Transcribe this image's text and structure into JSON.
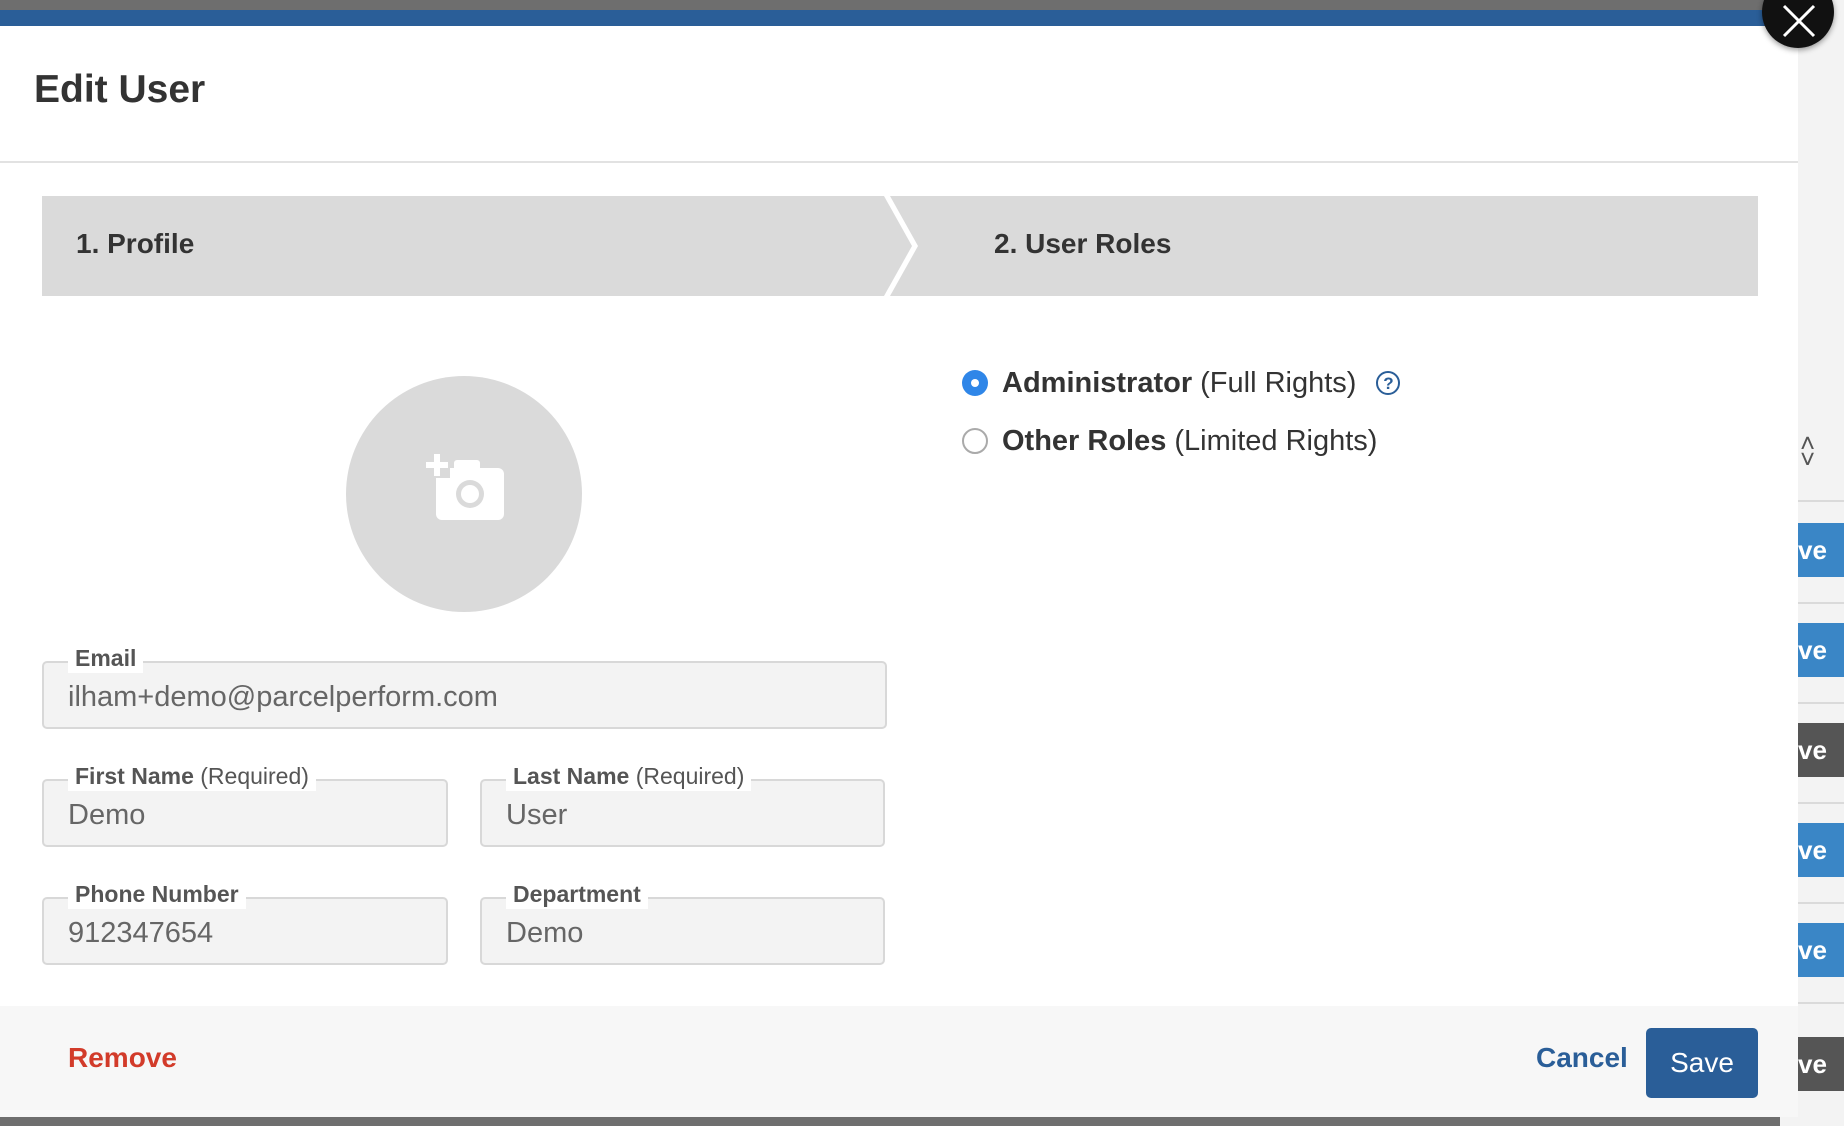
{
  "modal": {
    "title": "Edit User",
    "close_icon": "close-icon"
  },
  "steps": [
    {
      "label": "1. Profile"
    },
    {
      "label": "2. User Roles"
    }
  ],
  "profile": {
    "avatar_icon": "add-photo-icon",
    "email": {
      "label": "Email",
      "value": "ilham+demo@parcelperform.com"
    },
    "first_name": {
      "label": "First Name",
      "hint": "(Required)",
      "value": "Demo"
    },
    "last_name": {
      "label": "Last Name",
      "hint": "(Required)",
      "value": "User"
    },
    "phone": {
      "label": "Phone Number",
      "value": "912347654"
    },
    "department": {
      "label": "Department",
      "value": "Demo"
    }
  },
  "roles": [
    {
      "name": "Administrator",
      "detail": "(Full Rights)",
      "selected": true
    },
    {
      "name": "Other Roles",
      "detail": "(Limited Rights)",
      "selected": false
    }
  ],
  "help_icon": "help-icon",
  "footer": {
    "remove_label": "Remove",
    "cancel_label": "Cancel",
    "save_label": "Save"
  },
  "background": {
    "button_fragments": [
      "ve",
      "ve",
      "ve",
      "ve",
      "ve",
      "ve"
    ]
  },
  "colors": {
    "primary": "#2a5e98",
    "danger": "#d23b2a",
    "radio_selected": "#2f86e8",
    "step_bg": "#dadada"
  }
}
